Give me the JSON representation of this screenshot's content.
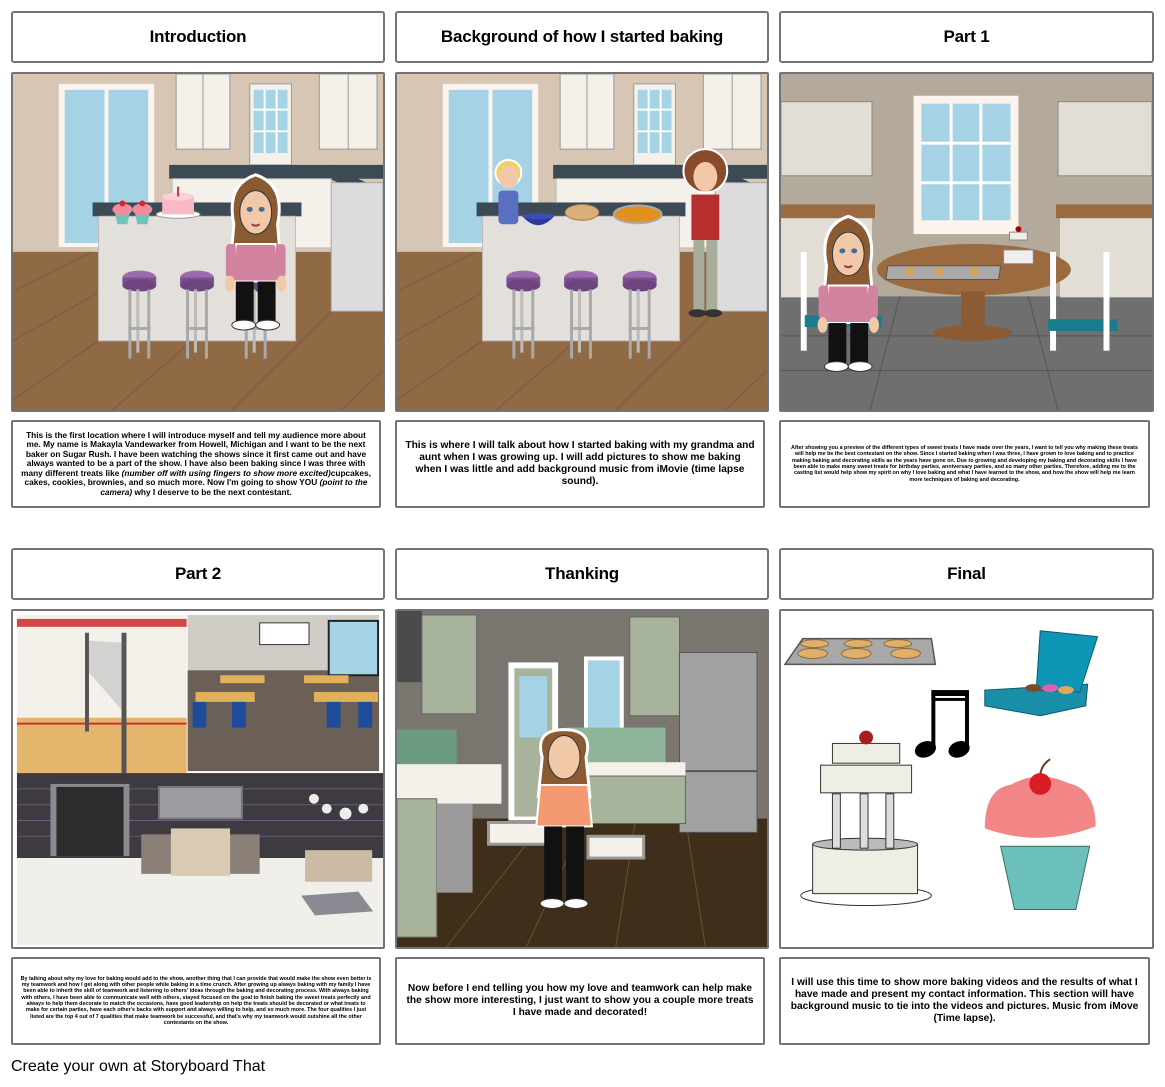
{
  "footer": "Create your own at Storyboard That",
  "panels": [
    {
      "title": "Introduction",
      "scene": "kitchen-island-intro",
      "caption": {
        "parts": [
          {
            "text": "This is the first location where I will introduce myself and tell my audience more about me. My name is Makayla Vandewarker from Howell, Michigan and I want to be the next baker on Sugar Rush. I have been watching the shows since it first came out and have always wanted to be a part of the show. I have also been baking since I was three with many different treats like ",
            "italic": false
          },
          {
            "text": "(number off with using fingers to show more excited)",
            "italic": true
          },
          {
            "text": "cupcakes, cakes, cookies, brownies, and so much more. Now I'm going to show YOU ",
            "italic": false
          },
          {
            "text": "(point to the camera)",
            "italic": true
          },
          {
            "text": " why I deserve to be the next contestant.",
            "italic": false
          }
        ]
      }
    },
    {
      "title": "Background of how I started baking",
      "scene": "kitchen-island-family",
      "caption": {
        "text": "This is where I will talk about how I started baking with my grandma and aunt when I was growing up. I will add pictures to show me baking when I was little and add background music from iMovie (time lapse sound)."
      }
    },
    {
      "title": "Part 1",
      "scene": "dining-table-cookies",
      "caption": {
        "text": "After showing you a preview of the different types of sweet treats I have made over the years, I want to tell you why making these treats will help me be the best contestant on the show. Since I started baking when I was three, I have grown to love baking and to practice making baking and decorating skills as the years have gone on. Due to growing and developing my baking and decorating skills I have been able to make many sweet treats for birthday parties, anniversary parties, and so many other parties. Therefore, adding me to the casting list would help show my spirit on why I love baking and what I have learned to the show, and how the show will help me learn more techniques of baking and decorating."
      }
    },
    {
      "title": "Part 2",
      "scene": "gym-classroom-lobby-collage",
      "caption": {
        "text": "By talking about why my love for baking would add to the show, another thing that I can provide that would make the show even better is my teamwork and how I get along with other people while baking in a time crunch. After growing up always baking with my family I have been able to inherit the skill of teamwork and listening to others' ideas through the baking and decorating process. With always baking with others, I have been able to communicate well with others, stayed focused on the goal to finish baking the sweet treats perfectly and always to help them decorate to match the occasions, have good leadership on help the treats should be decorated or what treats to make for certain parties, have each other's backs with support and always willing to help, and so much more. The four qualities I just listed are the top 4 out of 7 qualities that make teamwork be successful, and that's why my teamwork would outshine all the other contestants on the show."
      }
    },
    {
      "title": "Thanking",
      "scene": "green-kitchen-thinking",
      "caption": {
        "text": "Now before I end telling you how my love and teamwork can help make the show more interesting, I just want to show you a couple more treats I have made and decorated!"
      }
    },
    {
      "title": "Final",
      "scene": "treats-collage",
      "caption": {
        "text": "I will use this time to show more baking videos and the results of what I have made and present my contact information. This section will have background music to tie into the videos and pictures. Music from iMove (Time lapse)."
      }
    }
  ]
}
